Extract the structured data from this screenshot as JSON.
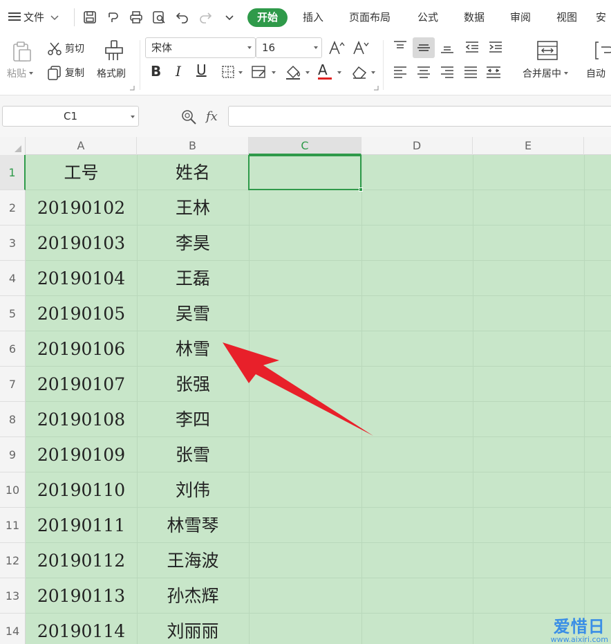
{
  "menubar": {
    "file_label": "文件",
    "tabs": [
      {
        "label": "开始",
        "active": true
      },
      {
        "label": "插入"
      },
      {
        "label": "页面布局"
      },
      {
        "label": "公式"
      },
      {
        "label": "数据"
      },
      {
        "label": "审阅"
      },
      {
        "label": "视图"
      },
      {
        "label": "安"
      }
    ]
  },
  "ribbon": {
    "paste_label": "粘贴",
    "cut_label": "剪切",
    "copy_label": "复制",
    "format_painter_label": "格式刷",
    "font_name": "宋体",
    "font_size": "16",
    "bold_glyph": "B",
    "italic_glyph": "I",
    "underline_glyph": "U",
    "font_color_glyph": "A",
    "merge_center_label": "合并居中",
    "auto_wrap_label": "自动"
  },
  "formula_bar": {
    "name_box": "C1",
    "fx_label": "fx",
    "formula_value": ""
  },
  "sheet": {
    "columns": [
      "A",
      "B",
      "C",
      "D",
      "E"
    ],
    "active_column": "C",
    "active_cell": "C1",
    "rows": [
      {
        "num": "1",
        "a": "工号",
        "b": "姓名"
      },
      {
        "num": "2",
        "a": "20190102",
        "b": "王林"
      },
      {
        "num": "3",
        "a": "20190103",
        "b": "李昊"
      },
      {
        "num": "4",
        "a": "20190104",
        "b": "王磊"
      },
      {
        "num": "5",
        "a": "20190105",
        "b": "吴雪"
      },
      {
        "num": "6",
        "a": "20190106",
        "b": "林雪"
      },
      {
        "num": "7",
        "a": "20190107",
        "b": "张强"
      },
      {
        "num": "8",
        "a": "20190108",
        "b": "李四"
      },
      {
        "num": "9",
        "a": "20190109",
        "b": "张雪"
      },
      {
        "num": "10",
        "a": "20190110",
        "b": "刘伟"
      },
      {
        "num": "11",
        "a": "20190111",
        "b": "林雪琴"
      },
      {
        "num": "12",
        "a": "20190112",
        "b": "王海波"
      },
      {
        "num": "13",
        "a": "20190113",
        "b": "孙杰辉"
      },
      {
        "num": "14",
        "a": "20190114",
        "b": "刘丽丽"
      }
    ]
  },
  "watermark": {
    "title": "爱惜日",
    "url": "www.aixiri.com"
  },
  "colors": {
    "accent": "#2f9a4a",
    "sheet_bg": "#c8e6c9",
    "arrow": "#e8202a"
  }
}
